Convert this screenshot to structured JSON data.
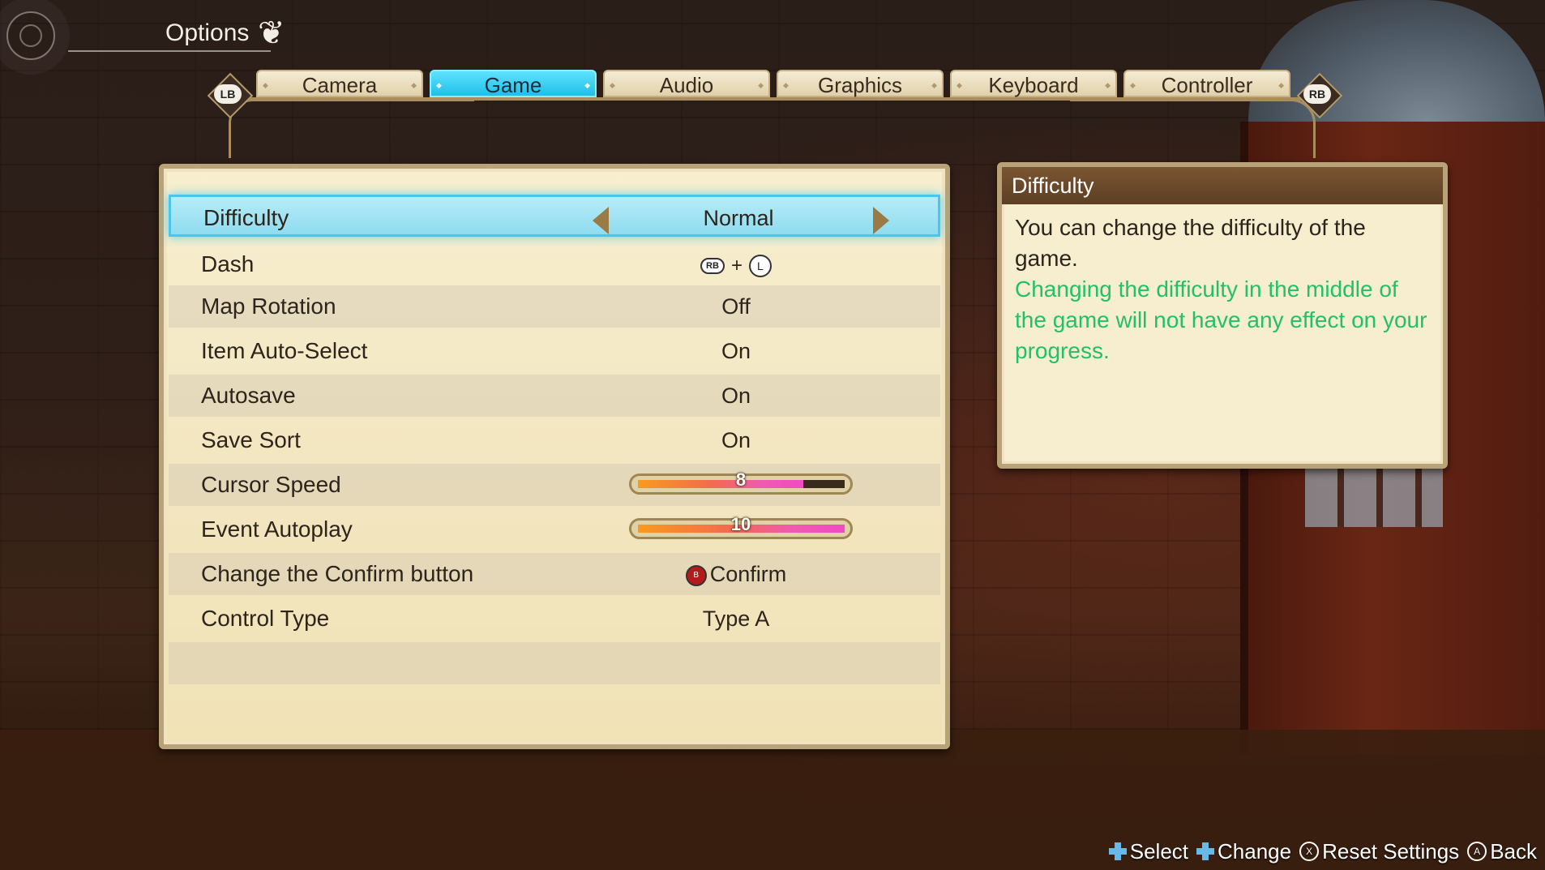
{
  "header": {
    "title": "Options"
  },
  "tabs": {
    "left_bumper": "LB",
    "right_bumper": "RB",
    "items": [
      "Camera",
      "Game",
      "Audio",
      "Graphics",
      "Keyboard",
      "Controller"
    ],
    "active": "Game"
  },
  "settings": {
    "difficulty": {
      "label": "Difficulty",
      "value": "Normal"
    },
    "dash": {
      "label": "Dash",
      "button": "RB",
      "plus": "+",
      "stick": "L"
    },
    "map_rotation": {
      "label": "Map Rotation",
      "value": "Off"
    },
    "item_auto_select": {
      "label": "Item Auto-Select",
      "value": "On"
    },
    "autosave": {
      "label": "Autosave",
      "value": "On"
    },
    "save_sort": {
      "label": "Save Sort",
      "value": "On"
    },
    "cursor_speed": {
      "label": "Cursor Speed",
      "value": "8",
      "fraction": 0.8
    },
    "event_autoplay": {
      "label": "Event Autoplay",
      "value": "10",
      "fraction": 1.0
    },
    "confirm_button": {
      "label": "Change the Confirm button",
      "glyph": "B",
      "value": "Confirm"
    },
    "control_type": {
      "label": "Control Type",
      "value": "Type A"
    }
  },
  "description": {
    "title": "Difficulty",
    "text": "You can change the difficulty of the game.",
    "note": "Changing the difficulty in the middle of the game will not have any effect on your progress."
  },
  "footer": {
    "select": "Select",
    "change": "Change",
    "reset_glyph": "X",
    "reset": "Reset Settings",
    "back_glyph": "A",
    "back": "Back"
  },
  "colors": {
    "active_tab": "#1fbfe8",
    "selection": "#48c6ef",
    "note_text": "#22c06b",
    "slider_start": "#f89b1d",
    "slider_end": "#f14ac5"
  }
}
